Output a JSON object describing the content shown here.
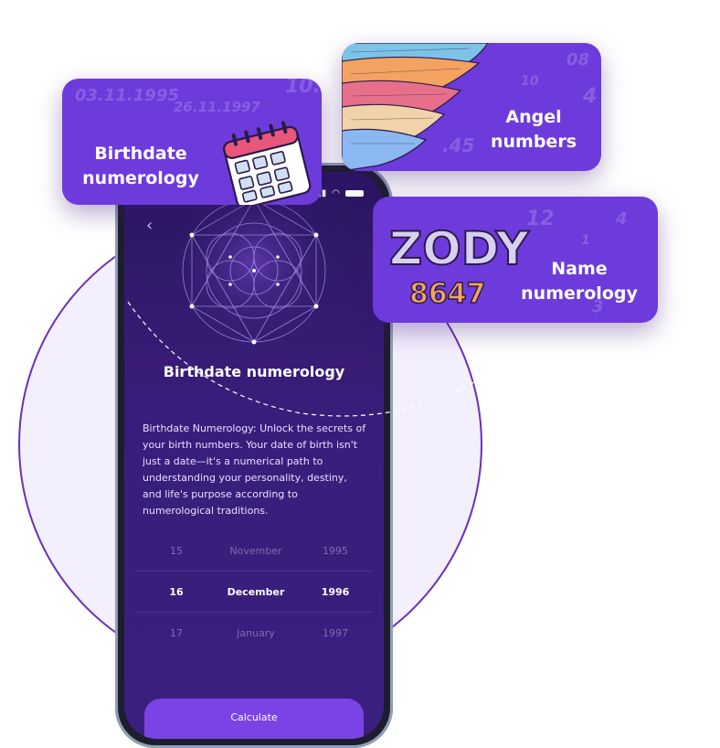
{
  "phone": {
    "screen_title": "Birthdate numerology",
    "description": "Birthdate Numerology: Unlock the secrets of your birth numbers. Your date of birth isn't just a date—it's a numerical path to understanding your personality, destiny, and life's purpose according to numerological traditions.",
    "picker": {
      "rows": [
        {
          "day": "15",
          "month": "November",
          "year": "1995"
        },
        {
          "day": "16",
          "month": "December",
          "year": "1996"
        },
        {
          "day": "17",
          "month": "January",
          "year": "1997"
        }
      ]
    },
    "calculate_label": "Calculate"
  },
  "cards": {
    "birthdate": {
      "label": "Birthdate numerology",
      "bg_text": [
        "03.11.1995",
        "26.11.1997",
        "10."
      ]
    },
    "angel": {
      "label": "Angel numbers",
      "bg_text": [
        "08",
        "10",
        "4",
        ".45"
      ]
    },
    "name": {
      "label": "Name numerology",
      "bg_text": [
        "12",
        "4",
        "1",
        "3"
      ],
      "logo_text": [
        "ZODY",
        "8647"
      ]
    }
  },
  "colors": {
    "accent": "#6d3bdb",
    "screen_bg": "#3a1d7a",
    "ring": "#6a2fb8",
    "circle_bg": "#f3effd"
  }
}
